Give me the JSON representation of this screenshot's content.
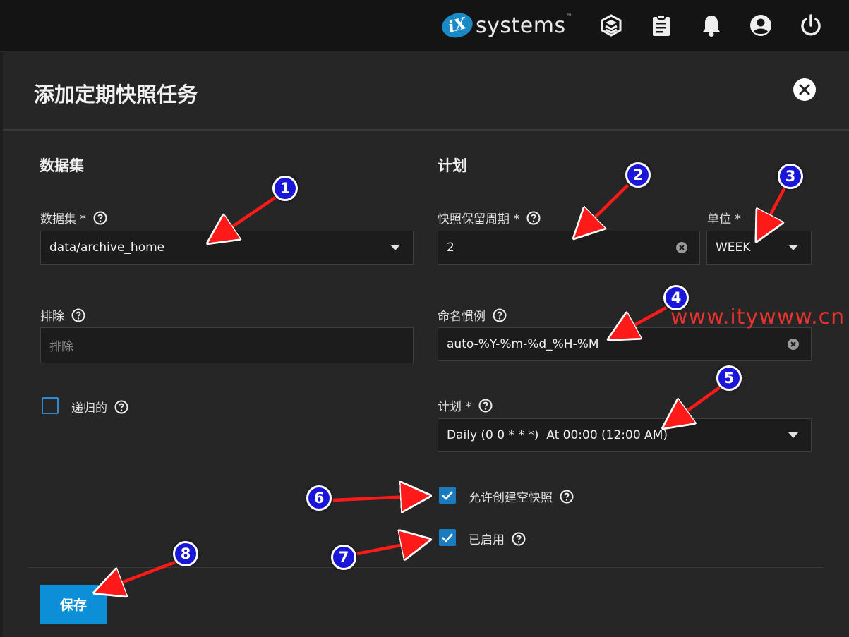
{
  "topbar": {
    "logo_mark": "iX",
    "logo_text": "systems",
    "logo_tm": "™",
    "icons": [
      "truecommand-icon",
      "clipboard-icon",
      "bell-icon",
      "account-circle-icon",
      "power-icon"
    ]
  },
  "dialog": {
    "title": "添加定期快照任务",
    "close_icon": "close-icon"
  },
  "dataset_section": {
    "title": "数据集",
    "dataset_label": "数据集 *",
    "dataset_value": "data/archive_home",
    "exclude_label": "排除",
    "exclude_placeholder": "排除",
    "recursive_label": "递归的",
    "recursive_checked": false
  },
  "schedule_section": {
    "title": "计划",
    "lifetime_label": "快照保留周期 *",
    "lifetime_value": "2",
    "unit_label": "单位 *",
    "unit_value": "WEEK",
    "naming_label": "命名惯例",
    "naming_value": "auto-%Y-%m-%d_%H-%M",
    "schedule_label": "计划 *",
    "schedule_value": "Daily (0 0 * * *)  At 00:00 (12:00 AM)",
    "allow_empty_label": "允许创建空快照",
    "allow_empty_checked": true,
    "enabled_label": "已启用",
    "enabled_checked": true
  },
  "actions": {
    "save_label": "保存"
  },
  "annotations": {
    "badges": [
      "1",
      "2",
      "3",
      "4",
      "5",
      "6",
      "7",
      "8"
    ],
    "arrow_color": "#ff1a1a",
    "badge_color": "#1a17d8"
  },
  "watermark": "www.itywww.cn",
  "colors": {
    "accent": "#0c8fd6",
    "panel_bg": "#262626",
    "topbar_bg": "#141414"
  }
}
